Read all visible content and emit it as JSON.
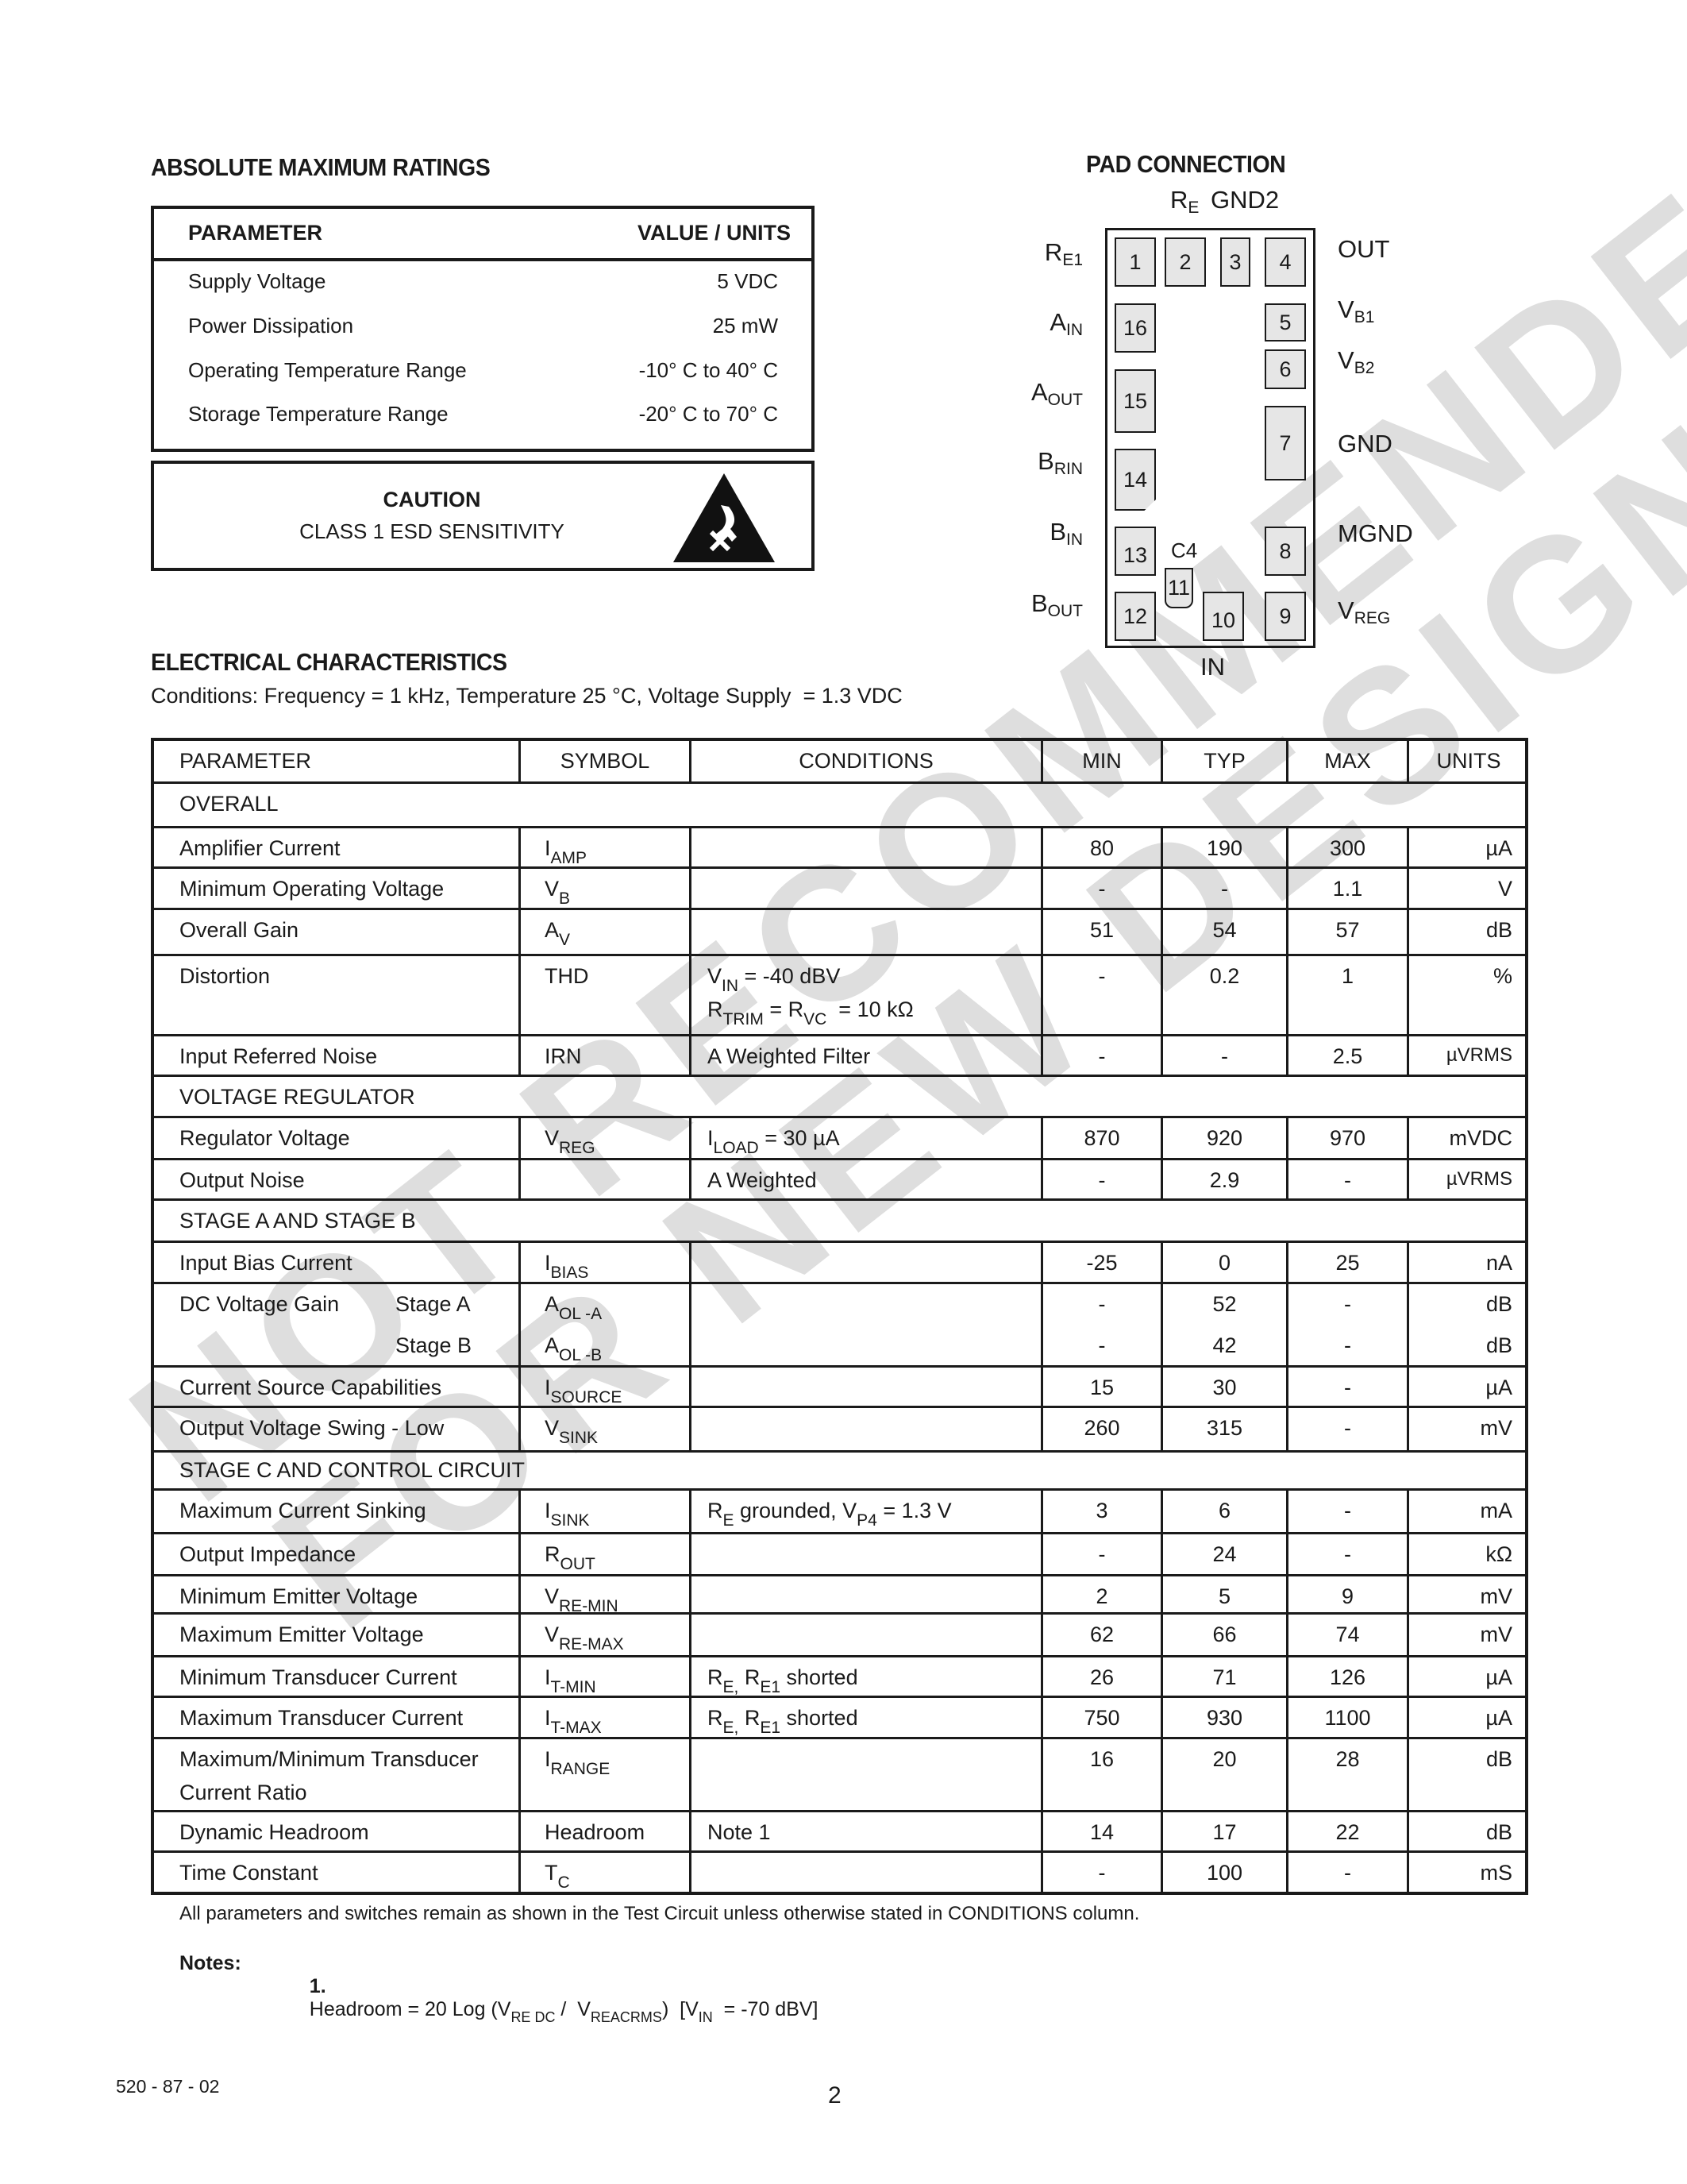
{
  "watermark": {
    "line1": "NOT RECOMMENDED",
    "line2": "FOR NEW DESIGNS",
    "color": "#dedede"
  },
  "absolute_maximum_ratings": {
    "title": "ABSOLUTE MAXIMUM RATINGS",
    "header": {
      "parameter": "PARAMETER",
      "value": "VALUE / UNITS"
    },
    "rows": [
      {
        "parameter": "Supply Voltage",
        "value": "5 VDC"
      },
      {
        "parameter": "Power Dissipation",
        "value": "25 mW"
      },
      {
        "parameter": "Operating Temperature Range",
        "value": "-10° C to 40° C"
      },
      {
        "parameter": "Storage Temperature Range",
        "value": "-20° C to 70° C"
      }
    ]
  },
  "caution": {
    "title": "CAUTION",
    "subtitle": "CLASS 1 ESD SENSITIVITY",
    "icon": "esd-warning-icon"
  },
  "pad_connection": {
    "title": "PAD CONNECTION",
    "top_labels": {
      "re": "R",
      "re_sub": "E",
      "gnd2": "GND2"
    },
    "bottom_label": "IN",
    "c4_label": "C4",
    "left_labels": [
      {
        "main": "R",
        "sub": "E1"
      },
      {
        "main": "A",
        "sub": "IN"
      },
      {
        "main": "A",
        "sub": "OUT"
      },
      {
        "main": "B",
        "sub": "RIN"
      },
      {
        "main": "B",
        "sub": "IN"
      },
      {
        "main": "B",
        "sub": "OUT"
      }
    ],
    "right_labels": [
      {
        "main": "OUT",
        "sub": ""
      },
      {
        "main": "V",
        "sub": "B1"
      },
      {
        "main": "V",
        "sub": "B2"
      },
      {
        "main": "GND",
        "sub": ""
      },
      {
        "main": "MGND",
        "sub": ""
      },
      {
        "main": "V",
        "sub": "REG"
      }
    ],
    "pads": [
      "1",
      "2",
      "3",
      "4",
      "5",
      "6",
      "7",
      "8",
      "9",
      "10",
      "11",
      "12",
      "13",
      "14",
      "15",
      "16"
    ]
  },
  "electrical_characteristics": {
    "title": "ELECTRICAL CHARACTERISTICS",
    "conditions": "Conditions: Frequency = 1 kHz, Temperature 25 °C, Voltage Supply  = 1.3 VDC",
    "columns": [
      "PARAMETER",
      "SYMBOL",
      "CONDITIONS",
      "MIN",
      "TYP",
      "MAX",
      "UNITS"
    ],
    "sections": {
      "overall": "OVERALL",
      "voltage_regulator": "VOLTAGE REGULATOR",
      "stage_ab": "STAGE A AND STAGE B",
      "stage_c": "STAGE C AND CONTROL CIRCUIT"
    },
    "rows": {
      "amp_current": {
        "parameter": "Amplifier Current",
        "sym": "I",
        "sym_sub": "AMP",
        "cond": "",
        "min": "80",
        "typ": "190",
        "max": "300",
        "units": "µA"
      },
      "min_op_voltage": {
        "parameter": "Minimum Operating Voltage",
        "sym": "V",
        "sym_sub": "B",
        "cond": "",
        "min": "-",
        "typ": "-",
        "max": "1.1",
        "units": "V"
      },
      "overall_gain": {
        "parameter": "Overall Gain",
        "sym": "A",
        "sym_sub": "V",
        "cond": "",
        "min": "51",
        "typ": "54",
        "max": "57",
        "units": "dB"
      },
      "distortion": {
        "parameter": "Distortion",
        "sym": "THD",
        "sym_sub": "",
        "cond1_main": "V",
        "cond1_sub": "IN",
        "cond1_rest": " = -40 dBV",
        "cond2_a": "R",
        "cond2_a_sub": "TRIM",
        "cond2_mid": " = R",
        "cond2_b_sub": "VC",
        "cond2_rest": "  = 10 kΩ",
        "min": "-",
        "typ": "0.2",
        "max": "1",
        "units": "%"
      },
      "irn": {
        "parameter": "Input Referred Noise",
        "sym": "IRN",
        "sym_sub": "",
        "cond": "A Weighted Filter",
        "min": "-",
        "typ": "-",
        "max": "2.5",
        "units": "µVRMS"
      },
      "reg_voltage": {
        "parameter": "Regulator Voltage",
        "sym": "V",
        "sym_sub": "REG",
        "cond_main": "I",
        "cond_sub": "LOAD",
        "cond_rest": " = 30 µA",
        "min": "870",
        "typ": "920",
        "max": "970",
        "units": "mVDC"
      },
      "output_noise": {
        "parameter": "Output Noise",
        "sym": "",
        "sym_sub": "",
        "cond": "A Weighted",
        "min": "-",
        "typ": "2.9",
        "max": "-",
        "units": "µVRMS"
      },
      "input_bias": {
        "parameter": "Input Bias Current",
        "sym": "I",
        "sym_sub": "BIAS",
        "cond": "",
        "min": "-25",
        "typ": "0",
        "max": "25",
        "units": "nA"
      },
      "dc_gain": {
        "parameter": "DC Voltage Gain",
        "stage_a": "Stage A",
        "stage_b": "Stage B",
        "sym_a": "A",
        "sym_a_sub": "OL -A",
        "sym_b": "A",
        "sym_b_sub": "OL -B",
        "min_a": "-",
        "typ_a": "52",
        "max_a": "-",
        "units_a": "dB",
        "min_b": "-",
        "typ_b": "42",
        "max_b": "-",
        "units_b": "dB"
      },
      "i_source": {
        "parameter": "Current Source Capabilities",
        "sym": "I",
        "sym_sub": "SOURCE",
        "cond": "",
        "min": "15",
        "typ": "30",
        "max": "-",
        "units": "µA"
      },
      "v_sink": {
        "parameter": "Output Voltage Swing - Low",
        "sym": "V",
        "sym_sub": "SINK",
        "cond": "",
        "min": "260",
        "typ": "315",
        "max": "-",
        "units": "mV"
      },
      "i_sink": {
        "parameter": "Maximum Current Sinking",
        "sym": "I",
        "sym_sub": "SINK",
        "cond_a": "R",
        "cond_a_sub": "E",
        "cond_mid": " grounded, V",
        "cond_b_sub": "P4",
        "cond_rest": " = 1.3 V",
        "min": "3",
        "typ": "6",
        "max": "-",
        "units": "mA"
      },
      "r_out": {
        "parameter": "Output Impedance",
        "sym": "R",
        "sym_sub": "OUT",
        "cond": "",
        "min": "-",
        "typ": "24",
        "max": "-",
        "units": "kΩ"
      },
      "v_re_min": {
        "parameter": "Minimum Emitter Voltage",
        "sym": "V",
        "sym_sub": "RE-MIN",
        "cond": "",
        "min": "2",
        "typ": "5",
        "max": "9",
        "units": "mV"
      },
      "v_re_max": {
        "parameter": "Maximum Emitter Voltage",
        "sym": "V",
        "sym_sub": "RE-MAX",
        "cond": "",
        "min": "62",
        "typ": "66",
        "max": "74",
        "units": "mV"
      },
      "i_t_min": {
        "parameter": "Minimum Transducer Current",
        "sym": "I",
        "sym_sub": "T-MIN",
        "cond_a": "R",
        "cond_a_sub": "E,",
        "cond_mid": " R",
        "cond_b_sub": "E1",
        "cond_rest": " shorted",
        "min": "26",
        "typ": "71",
        "max": "126",
        "units": "µA"
      },
      "i_t_max": {
        "parameter": "Maximum Transducer Current",
        "sym": "I",
        "sym_sub": "T-MAX",
        "cond_a": "R",
        "cond_a_sub": "E,",
        "cond_mid": " R",
        "cond_b_sub": "E1",
        "cond_rest": " shorted",
        "min": "750",
        "typ": "930",
        "max": "1100",
        "units": "µA"
      },
      "i_range": {
        "parameter_1": "Maximum/Minimum Transducer",
        "parameter_2": "Current Ratio",
        "sym": "I",
        "sym_sub": "RANGE",
        "cond": "",
        "min": "16",
        "typ": "20",
        "max": "28",
        "units": "dB"
      },
      "headroom": {
        "parameter": "Dynamic Headroom",
        "sym": "Headroom",
        "sym_sub": "",
        "cond": "Note 1",
        "min": "14",
        "typ": "17",
        "max": "22",
        "units": "dB"
      },
      "time_constant": {
        "parameter": "Time Constant",
        "sym": "T",
        "sym_sub": "C",
        "cond": "",
        "min": "-",
        "typ": "100",
        "max": "-",
        "units": "mS"
      }
    },
    "footnote": "All parameters and switches remain as shown in the Test Circuit unless otherwise stated in CONDITIONS column.",
    "notes_label": "Notes:",
    "note1": {
      "number": "1.",
      "text_a": "Headroom = 20 Log (V",
      "sub_a": "RE DC",
      "text_b": " /  V",
      "sub_b": "REACRMS",
      "text_c": ")  [V",
      "sub_c": "IN",
      "text_d": "  = -70 dBV]"
    }
  },
  "footer": {
    "doc_code": "520 - 87 - 02",
    "page_number": "2"
  }
}
